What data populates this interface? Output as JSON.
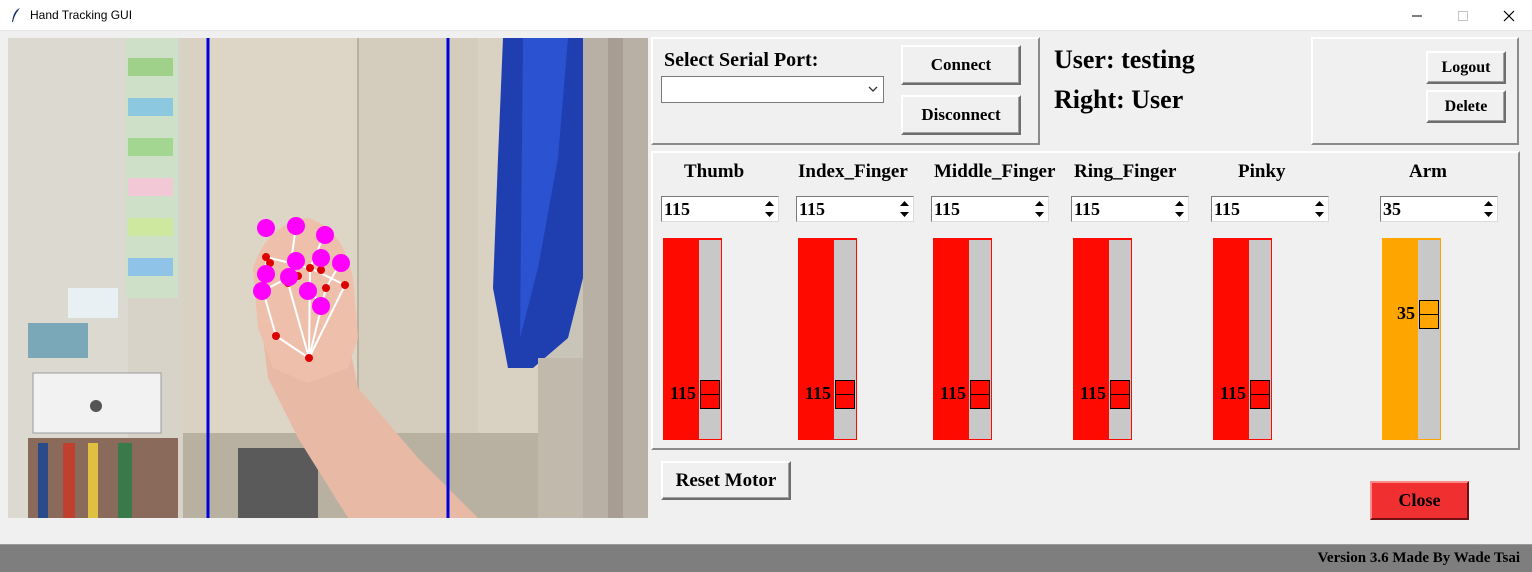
{
  "window": {
    "title": "Hand Tracking GUI"
  },
  "serial": {
    "label": "Select Serial Port:",
    "selected": "",
    "connect_label": "Connect",
    "disconnect_label": "Disconnect"
  },
  "user": {
    "user_text": "User: testing",
    "role_text": "Right: User",
    "logout_label": "Logout",
    "delete_label": "Delete"
  },
  "motors": [
    {
      "name": "Thumb",
      "value": "115",
      "fraction": 0.82,
      "color": "#ff0a00"
    },
    {
      "name": "Index_Finger",
      "value": "115",
      "fraction": 0.82,
      "color": "#ff0a00"
    },
    {
      "name": "Middle_Finger",
      "value": "115",
      "fraction": 0.82,
      "color": "#ff0a00"
    },
    {
      "name": "Ring_Finger",
      "value": "115",
      "fraction": 0.82,
      "color": "#ff0a00"
    },
    {
      "name": "Pinky",
      "value": "115",
      "fraction": 0.82,
      "color": "#ff0a00"
    },
    {
      "name": "Arm",
      "value": "35",
      "fraction": 0.35,
      "color": "#ffa500"
    }
  ],
  "actions": {
    "reset_label": "Reset Motor",
    "close_label": "Close"
  },
  "status": {
    "text": "Version 3.6  Made By Wade Tsai"
  },
  "colors": {
    "slider_red": "#ff0a00",
    "slider_orange": "#ffa500",
    "close_button": "#f03030",
    "landmark_magenta": "#ff00ff",
    "guide_lines": "#0000dd"
  },
  "camera": {
    "description_icons": "hand-landmarks-overlay"
  }
}
